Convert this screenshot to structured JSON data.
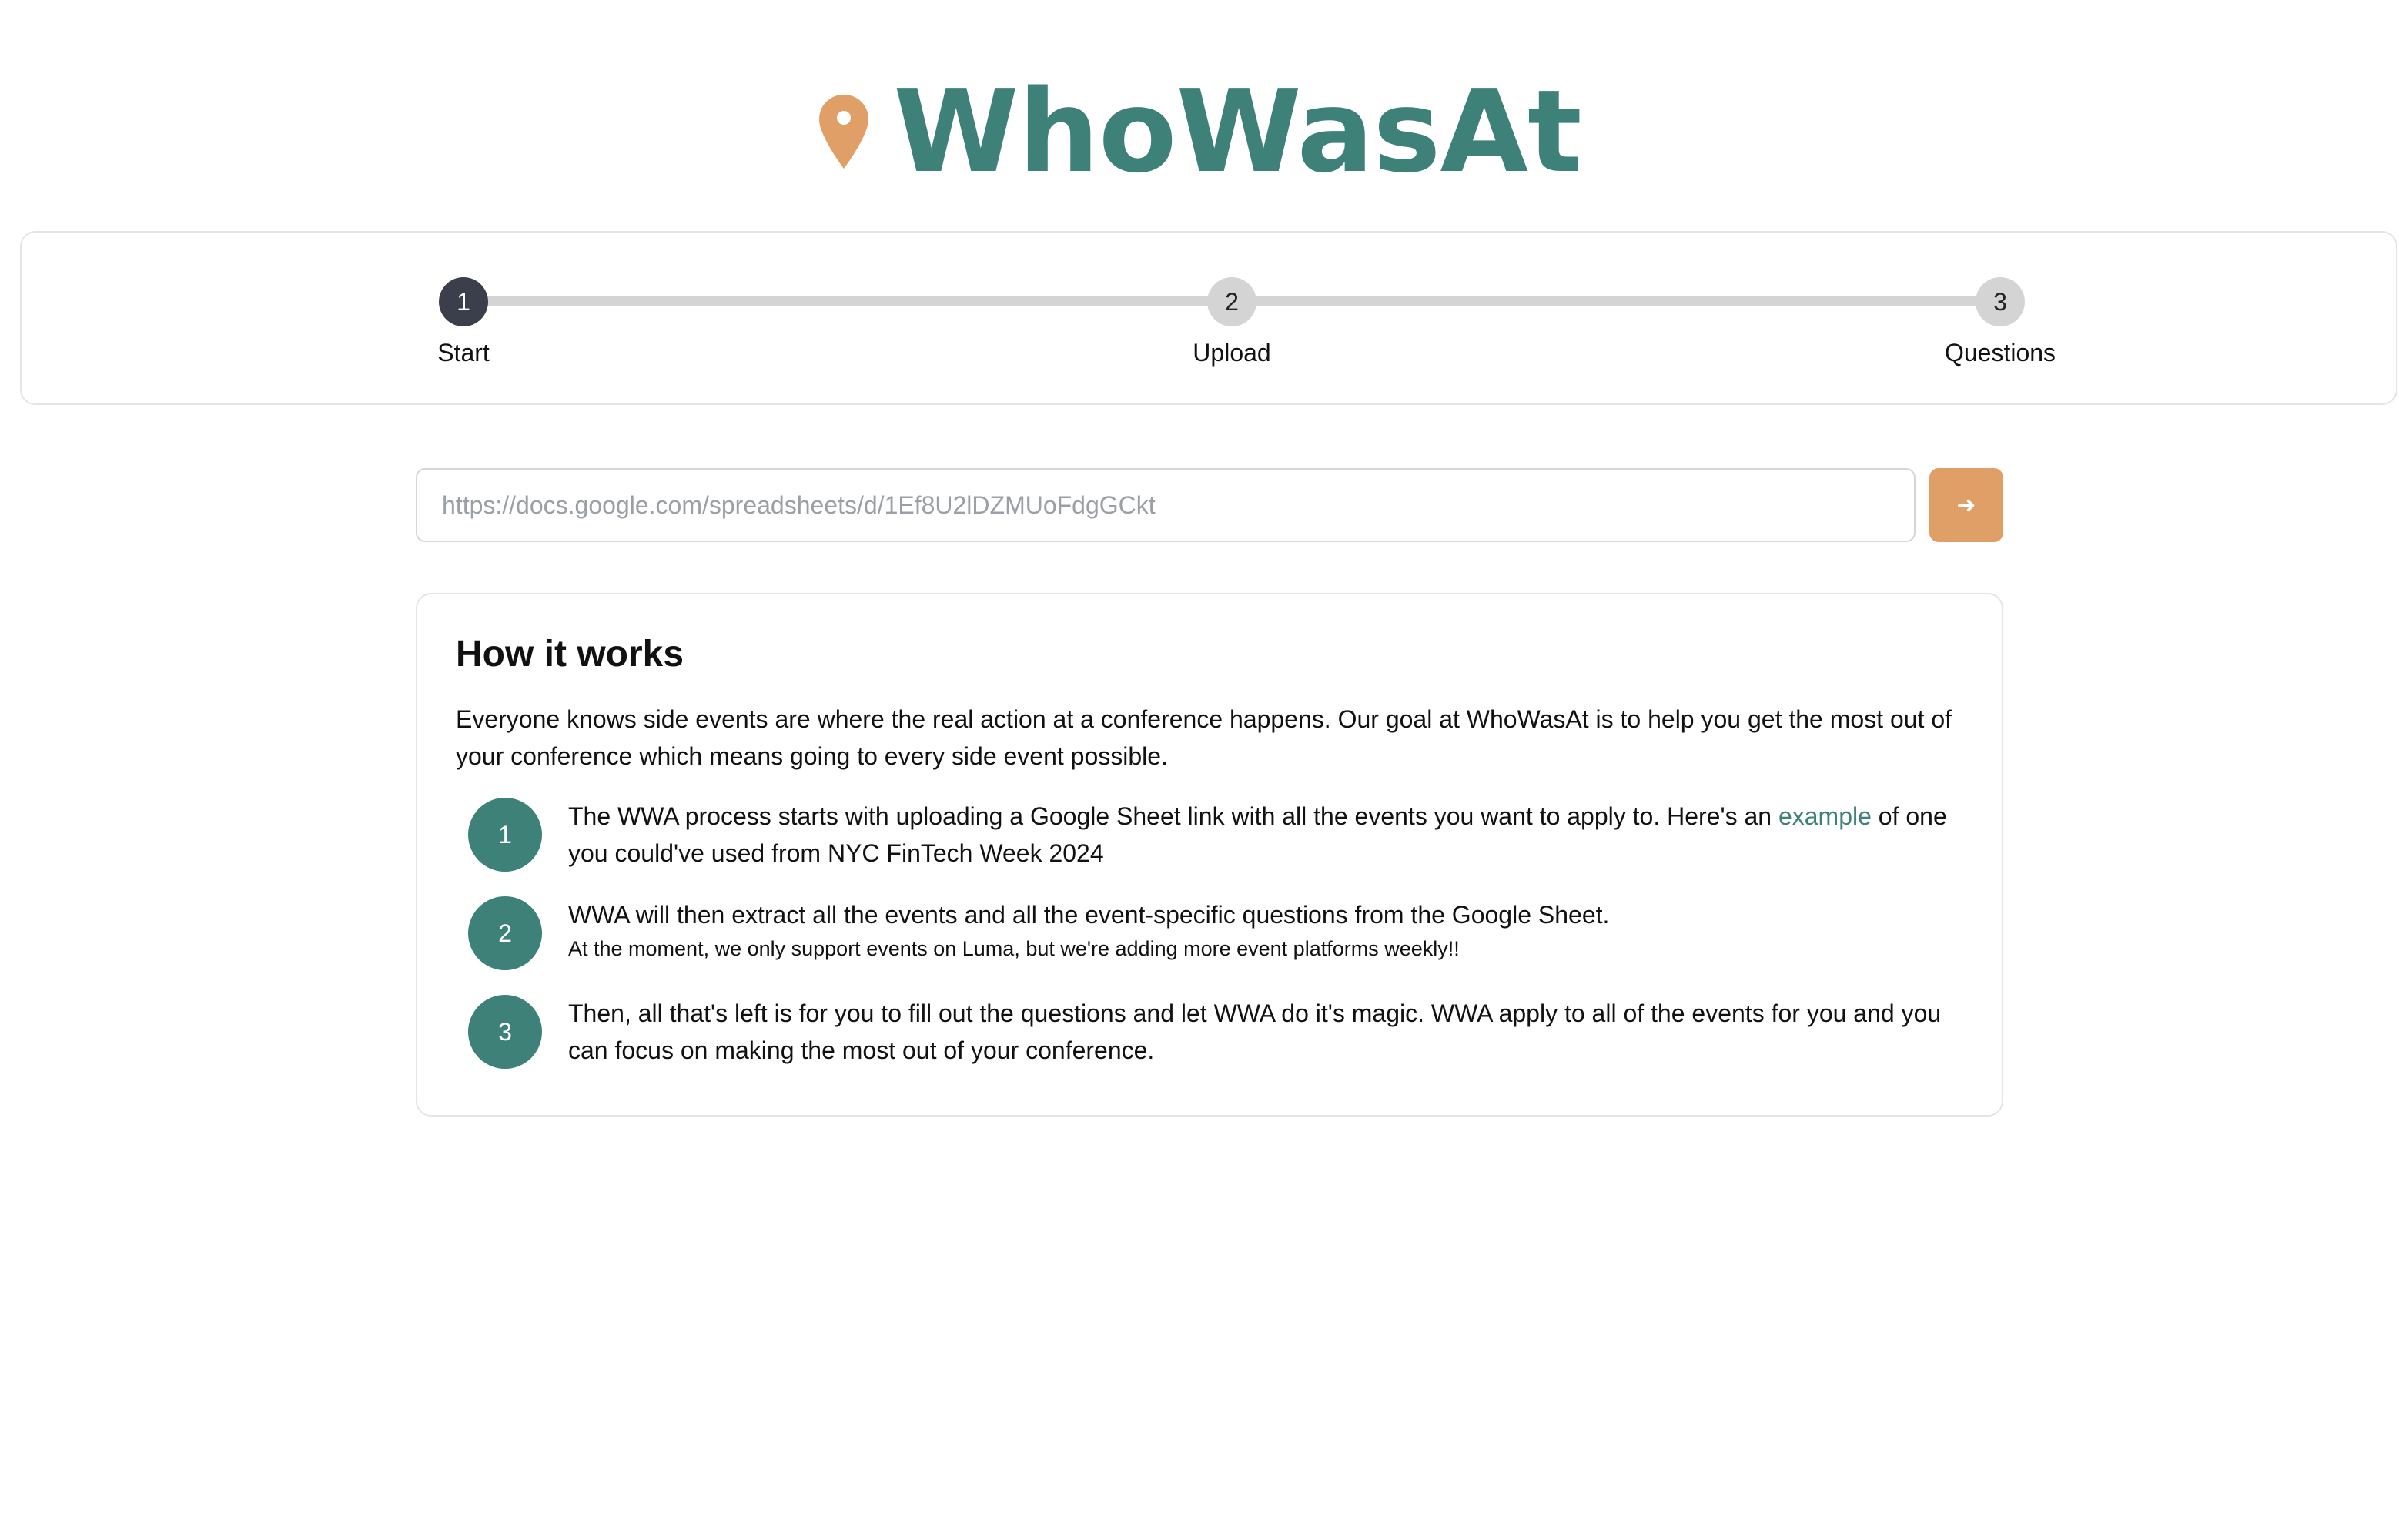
{
  "app": {
    "name": "WhoWasAt",
    "brand_color": "#3e8179",
    "accent_color": "#e19f68",
    "logo_icon": "map-pin-icon"
  },
  "stepper": {
    "steps": [
      {
        "number": "1",
        "label": "Start",
        "active": true
      },
      {
        "number": "2",
        "label": "Upload",
        "active": false
      },
      {
        "number": "3",
        "label": "Questions",
        "active": false
      }
    ]
  },
  "url_form": {
    "placeholder": "https://docs.google.com/spreadsheets/d/1Ef8U2lDZMUoFdgGCkt",
    "value": "",
    "submit_icon": "arrow-right-icon",
    "submit_glyph": "➜"
  },
  "how_it_works": {
    "title": "How it works",
    "intro": "Everyone knows side events are where the real action at a conference happens. Our goal at WhoWasAt is to help you get the most out of your conference which means going to every side event possible.",
    "steps": [
      {
        "number": "1",
        "text_before": "The WWA process starts with uploading a Google Sheet link with all the events you want to apply to. Here's an ",
        "link_text": "example",
        "text_after": " of one you could've used from NYC FinTech Week 2024"
      },
      {
        "number": "2",
        "text": "WWA will then extract all the events and all the event-specific questions from the Google Sheet.",
        "note": "At the moment, we only support events on Luma, but we're adding more event platforms weekly!!"
      },
      {
        "number": "3",
        "text": "Then, all that's left is for you to fill out the questions and let WWA do it's magic. WWA apply to all of the events for you and you can focus on making the most out of your conference."
      }
    ]
  }
}
